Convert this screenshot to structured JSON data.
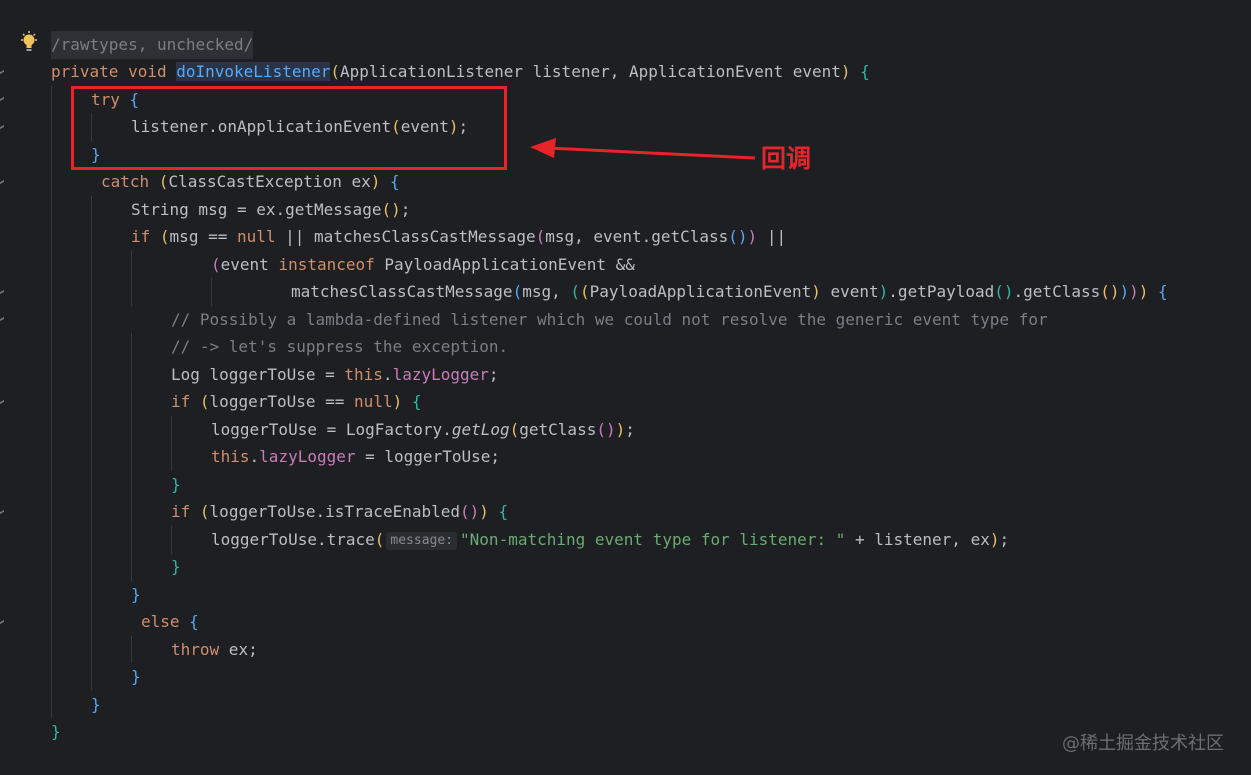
{
  "code": {
    "annotation": "/rawtypes, unchecked/",
    "sig_kw": "private void ",
    "method_name": "doInvokeListener",
    "sig_params_open": "(",
    "sig_params": "ApplicationListener listener, ApplicationEvent event",
    "sig_params_close": ")",
    "sig_brace": " {",
    "try_kw": "try ",
    "try_brace": "{",
    "call_line": "listener.onApplicationEvent",
    "call_paren_open": "(",
    "call_arg": "event",
    "call_paren_close": ")",
    "call_semi": ";",
    "close_brace": "}",
    "catch_kw": "catch ",
    "catch_open": "(",
    "catch_params": "ClassCastException ex",
    "catch_close": ")",
    "catch_brace": " {",
    "msg_line_a": "String msg = ex.getMessage",
    "msg_line_paren": "()",
    "msg_line_semi": ";",
    "if_kw": "if ",
    "if_open": "(",
    "if_cond_a": "msg == ",
    "null_kw": "null",
    "if_cond_b": " || matchesClassCastMessage",
    "if_cond_c": "msg, event.getClass",
    "if_cond_d": " ||",
    "instanceof_open": "(",
    "instanceof_a": "event ",
    "instanceof_kw": "instanceof",
    "instanceof_b": " PayloadApplicationEvent &&",
    "match2_a": "matchesClassCastMessage",
    "match2_b": "msg, ",
    "match2_c": "PayloadApplicationEvent",
    "match2_d": " event",
    "match2_e": ".getPayload",
    "match2_f": ".getClass",
    "match2_end": " {",
    "comment1": "// Possibly a lambda-defined listener which we could not resolve the generic event type for",
    "comment2": "// -> let's suppress the exception.",
    "log_a": "Log loggerToUse = ",
    "this_kw": "this",
    "dot": ".",
    "lazy_logger": "lazyLogger",
    "semi": ";",
    "if2_a": "loggerToUse == ",
    "if2_b": " {",
    "assign_a": "loggerToUse = LogFactory.",
    "get_log": "getLog",
    "assign_b": "getClass",
    "this_assign_b": " = loggerToUse;",
    "if3_a": "loggerToUse.isTraceEnabled",
    "trace_a": "loggerToUse.trace",
    "trace_hint": "message:",
    "trace_str": "\"Non-matching event type for listener: \"",
    "trace_b": " + listener, ex",
    "else_kw": "else ",
    "throw_kw": "throw",
    "throw_b": " ex;",
    "paren_pair": "()"
  },
  "annotation_label": "回调",
  "watermark": "@稀土掘金技术社区",
  "colors": {
    "background": "#1e1f22",
    "keyword": "#cf8e6d",
    "method": "#57aaf7",
    "string": "#6aab73",
    "comment": "#7a7e85",
    "annotation_red": "#e8242b"
  }
}
